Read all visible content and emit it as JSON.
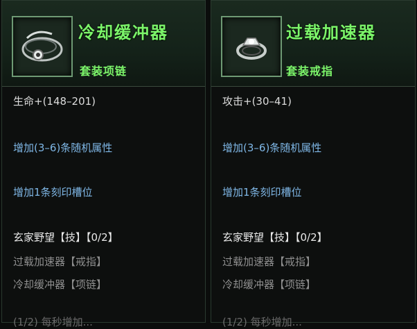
{
  "panels": [
    {
      "icon": "necklace-icon",
      "name": "冷却缓冲器",
      "type": "套装项链",
      "stat": "生命+(148–201)",
      "random_affix": "增加(3–6)条随机属性",
      "engrave_slot": "增加1条刻印槽位",
      "set_bonus": "玄家野望【技】【0/2】",
      "set_members": [
        "过载加速器【戒指】",
        "冷却缓冲器【项链】"
      ],
      "cut_text": "(1/2) 每秒增加..."
    },
    {
      "icon": "ring-icon",
      "name": "过载加速器",
      "type": "套装戒指",
      "stat": "攻击+(30–41)",
      "random_affix": "增加(3–6)条随机属性",
      "engrave_slot": "增加1条刻印槽位",
      "set_bonus": "玄家野望【技】【0/2】",
      "set_members": [
        "过载加速器【戒指】",
        "冷却缓冲器【项链】"
      ],
      "cut_text": "(1/2) 每秒增加..."
    }
  ],
  "colors": {
    "title_green": "#7cf56a",
    "affix_blue": "#7fb7e6",
    "inactive_grey": "#8f8f8f",
    "icon_border": "#6e9a74"
  }
}
